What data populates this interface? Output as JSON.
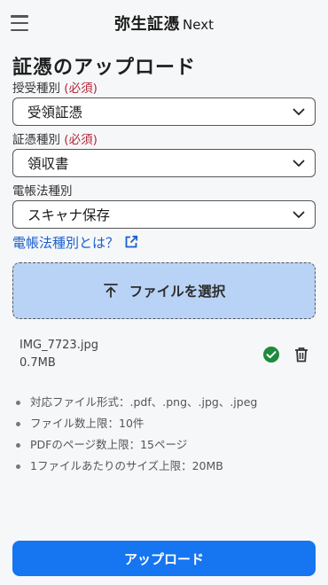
{
  "header": {
    "logo_main": "弥生証憑",
    "logo_sub": "Next",
    "menu_icon": "hamburger-menu-icon"
  },
  "page_title": "証憑のアップロード",
  "fields": {
    "transaction_type": {
      "label": "授受種別",
      "required": "(必須)",
      "value": "受領証憑"
    },
    "document_type": {
      "label": "証憑種別",
      "required": "(必須)",
      "value": "領収書"
    },
    "ledger_type": {
      "label": "電帳法種別",
      "value": "スキャナ保存"
    }
  },
  "help_link": {
    "label": "電帳法種別とは？",
    "icon": "external-link-icon"
  },
  "dropzone": {
    "label": "ファイルを選択",
    "icon": "upload-icon"
  },
  "file": {
    "name": "IMG_7723.jpg",
    "size": "0.7MB",
    "status_icon": "check-circle-icon",
    "status_color": "#1e8a3c",
    "delete_icon": "trash-icon"
  },
  "notes": [
    "対応ファイル形式：.pdf、.png、.jpg、.jpeg",
    "ファイル数上限：10件",
    "PDFのページ数上限：15ページ",
    "1ファイルあたりのサイズ上限：20MB"
  ],
  "upload_button": {
    "label": "アップロード",
    "color": "#1675f0"
  }
}
